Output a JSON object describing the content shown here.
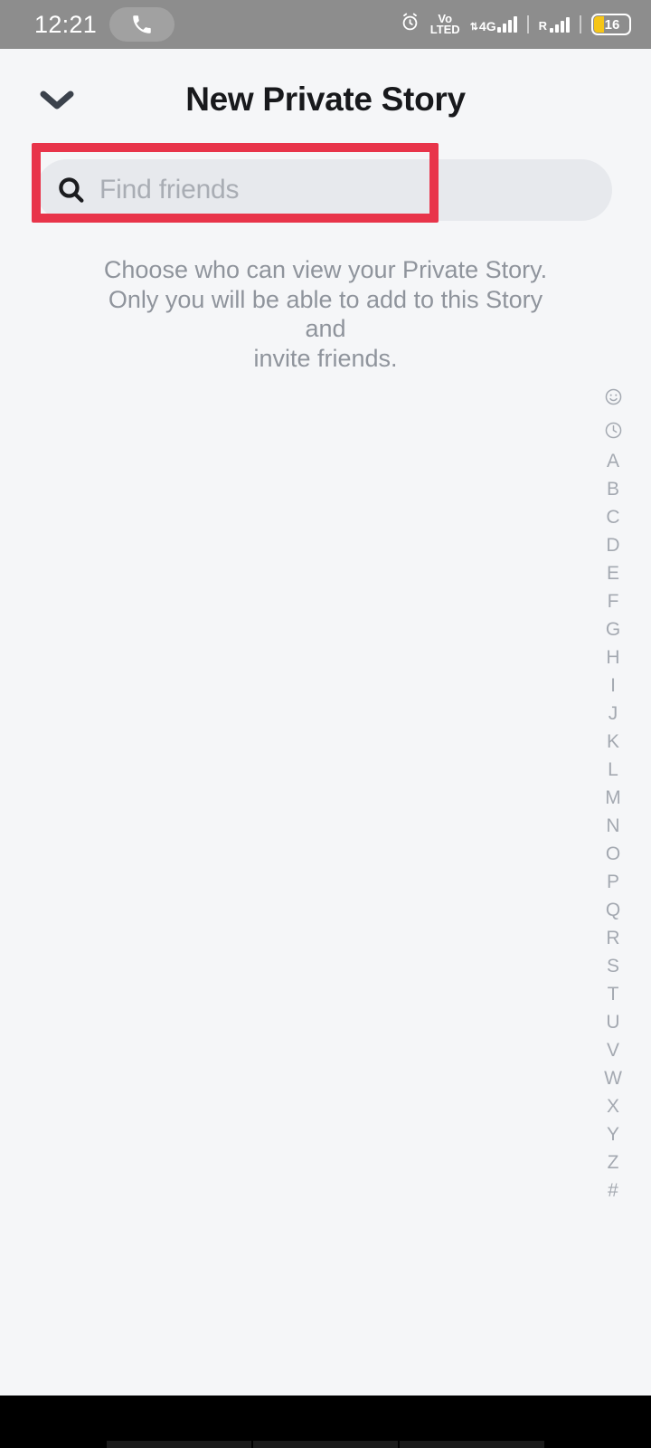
{
  "status_bar": {
    "time": "12:21",
    "phone_icon": "phone-handset-icon",
    "alarm_icon": "alarm-clock-icon",
    "volte_top": "Vo",
    "volte_bottom": "LTED",
    "network_type": "4G",
    "data_arrows": "⇅",
    "roaming_label": "R",
    "battery_percent": "16",
    "background_color": "#8d8d8d"
  },
  "header": {
    "back_icon": "chevron-down-icon",
    "title": "New Private Story"
  },
  "search": {
    "icon": "search-icon",
    "placeholder": "Find friends",
    "value": "",
    "pill_color": "#e7e9ed"
  },
  "annotation": {
    "type": "highlight-rectangle",
    "color": "#e8344a",
    "target": "search-input"
  },
  "description": {
    "line1": "Choose who can view your Private Story.",
    "line2": "Only you will be able to add to this Story and",
    "line3": "invite friends.",
    "full_text": "Choose who can view your Private Story. Only you will be able to add to this Story and invite friends."
  },
  "alpha_index": {
    "icons": [
      "smiley-face-icon",
      "clock-icon"
    ],
    "letters": [
      "A",
      "B",
      "C",
      "D",
      "E",
      "F",
      "G",
      "H",
      "I",
      "J",
      "K",
      "L",
      "M",
      "N",
      "O",
      "P",
      "Q",
      "R",
      "S",
      "T",
      "U",
      "V",
      "W",
      "X",
      "Y",
      "Z",
      "#"
    ],
    "color": "#a4a9b1"
  },
  "colors": {
    "page_background": "#f5f6f8",
    "title_text": "#18191c",
    "muted_text": "#8f949c",
    "accent_red": "#e8344a",
    "nav_bar": "#000000"
  }
}
